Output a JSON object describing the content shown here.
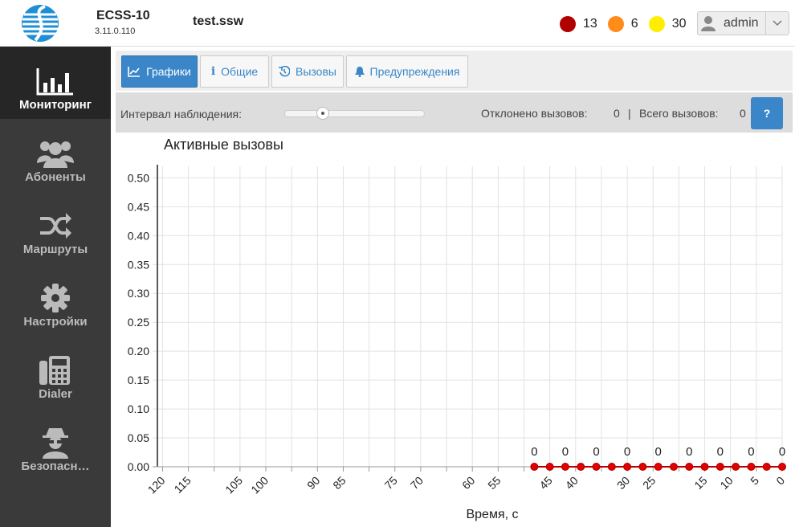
{
  "header": {
    "app_name": "ECSS-10",
    "version": "3.11.0.110",
    "file_name": "test.ssw",
    "alarms": [
      {
        "count": "13",
        "color": "#b00000"
      },
      {
        "count": "6",
        "color": "#ff8c1a"
      },
      {
        "count": "30",
        "color": "#ffee00"
      }
    ],
    "user": "admin"
  },
  "sidebar": {
    "items": [
      {
        "label": "Мониторинг",
        "icon": "bar-chart-icon",
        "active": true
      },
      {
        "label": "Абоненты",
        "icon": "users-icon",
        "active": false
      },
      {
        "label": "Маршруты",
        "icon": "shuffle-icon",
        "active": false
      },
      {
        "label": "Настройки",
        "icon": "gear-icon",
        "active": false
      },
      {
        "label": "Dialer",
        "icon": "fax-icon",
        "active": false
      },
      {
        "label": "Безопасн…",
        "icon": "spy-icon",
        "active": false
      }
    ]
  },
  "tabs": [
    {
      "label": "Графики",
      "icon": "line-chart-icon",
      "active": true
    },
    {
      "label": "Общие",
      "icon": "info-icon",
      "active": false
    },
    {
      "label": "Вызовы",
      "icon": "history-icon",
      "active": false
    },
    {
      "label": "Предупреждения",
      "icon": "bell-icon",
      "active": false
    }
  ],
  "toolbar": {
    "interval_label": "Интервал наблюдения:",
    "rejected_label": "Отклонено вызовов:",
    "rejected_value": "0",
    "separator": "|",
    "total_label": "Всего вызовов:",
    "total_value": "0",
    "help_label": "?"
  },
  "chart_data": {
    "type": "line",
    "title": "Активные вызовы",
    "xlabel": "Время, с",
    "ylabel": "",
    "xlim": [
      121,
      0
    ],
    "ylim": [
      0,
      0.52
    ],
    "yticks": [
      0.0,
      0.05,
      0.1,
      0.15,
      0.2,
      0.25,
      0.3,
      0.35,
      0.4,
      0.45,
      0.5
    ],
    "ytick_labels": [
      "0.00",
      "0.05",
      "0.10",
      "0.15",
      "0.20",
      "0.25",
      "0.30",
      "0.35",
      "0.40",
      "0.45",
      "0.50"
    ],
    "xticks": [
      120,
      115,
      105,
      100,
      90,
      85,
      75,
      70,
      60,
      55,
      45,
      40,
      30,
      25,
      15,
      10,
      5,
      0
    ],
    "xtick_labels": [
      "120",
      "115",
      "105",
      "100",
      "90",
      "85",
      "75",
      "70",
      "60",
      "55",
      "45",
      "40",
      "30",
      "25",
      "15",
      "10",
      "5",
      "0"
    ],
    "grid": true,
    "line_color": "#b00000",
    "point_color": "#e00000",
    "series": [
      {
        "x": [
          48,
          45,
          42,
          39,
          36,
          33,
          30,
          27,
          24,
          21,
          18,
          15,
          12,
          9,
          6,
          3,
          0
        ],
        "y": [
          0,
          0,
          0,
          0,
          0,
          0,
          0,
          0,
          0,
          0,
          0,
          0,
          0,
          0,
          0,
          0,
          0
        ]
      }
    ],
    "data_labels": [
      {
        "x": 48,
        "text": "0"
      },
      {
        "x": 42,
        "text": "0"
      },
      {
        "x": 36,
        "text": "0"
      },
      {
        "x": 30,
        "text": "0"
      },
      {
        "x": 24,
        "text": "0"
      },
      {
        "x": 18,
        "text": "0"
      },
      {
        "x": 12,
        "text": "0"
      },
      {
        "x": 6,
        "text": "0"
      },
      {
        "x": 0,
        "text": "0"
      }
    ]
  }
}
